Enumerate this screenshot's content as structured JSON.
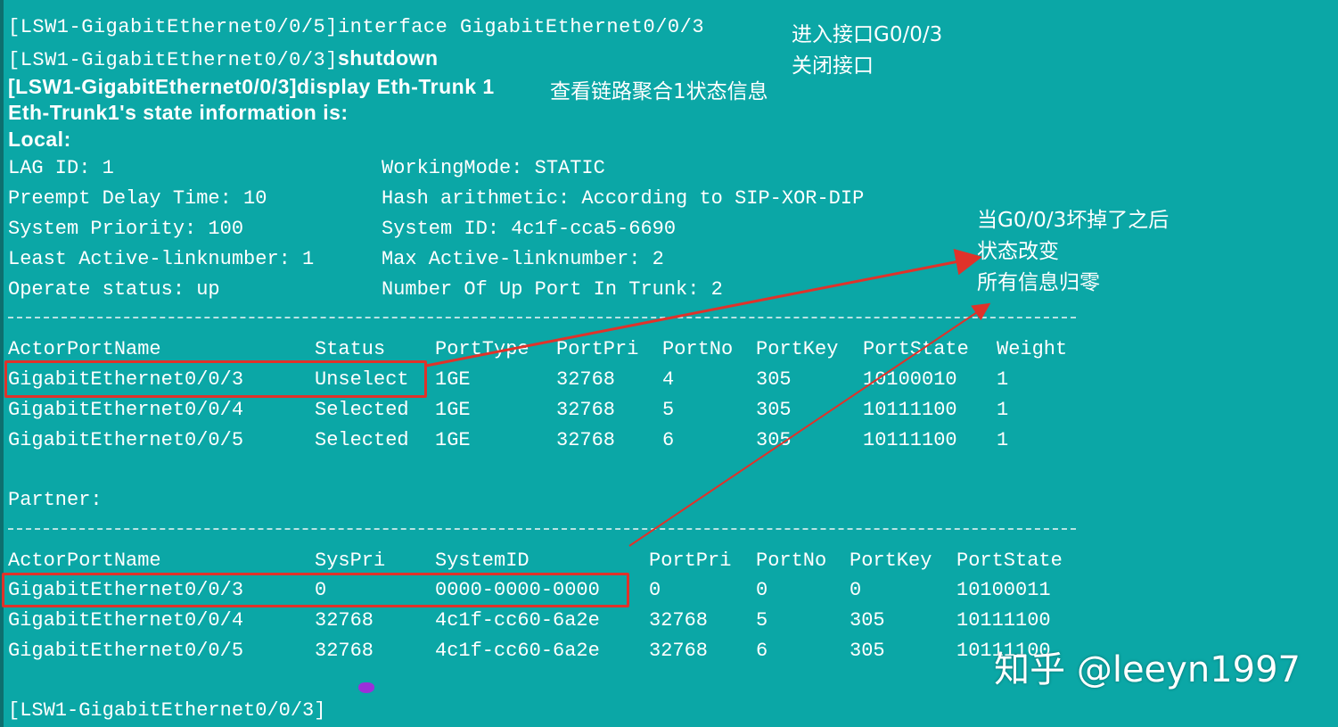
{
  "terminal": {
    "lines": {
      "cmd1": "[LSW1-GigabitEthernet0/0/5]interface GigabitEthernet0/0/3",
      "cmd2_prompt": "[LSW1-GigabitEthernet0/0/3]",
      "cmd2_cmd": "shutdown",
      "cmd3": "[LSW1-GigabitEthernet0/0/3]display Eth-Trunk 1",
      "state_header": "Eth-Trunk1's state information is:",
      "local": "Local:",
      "lag_id": "LAG ID: 1",
      "working_mode": "WorkingMode: STATIC",
      "preempt": "Preempt Delay Time: 10",
      "hash": "Hash arithmetic: According to SIP-XOR-DIP",
      "sys_priority": "System Priority: 100",
      "system_id": "System ID: 4c1f-cca5-6690",
      "least_active": "Least Active-linknumber: 1",
      "max_active": "Max Active-linknumber: 2",
      "operate_status": "Operate status: up",
      "up_ports": "Number Of Up Port In Trunk: 2",
      "partner": "Partner:",
      "final_prompt": "[LSW1-GigabitEthernet0/0/3]"
    },
    "local_table": {
      "headers": [
        "ActorPortName",
        "Status",
        "PortType",
        "PortPri",
        "PortNo",
        "PortKey",
        "PortState",
        "Weight"
      ],
      "rows": [
        [
          "GigabitEthernet0/0/3",
          "Unselect",
          "1GE",
          "32768",
          "4",
          "305",
          "10100010",
          "1"
        ],
        [
          "GigabitEthernet0/0/4",
          "Selected",
          "1GE",
          "32768",
          "5",
          "305",
          "10111100",
          "1"
        ],
        [
          "GigabitEthernet0/0/5",
          "Selected",
          "1GE",
          "32768",
          "6",
          "305",
          "10111100",
          "1"
        ]
      ]
    },
    "partner_table": {
      "headers": [
        "ActorPortName",
        "SysPri",
        "SystemID",
        "PortPri",
        "PortNo",
        "PortKey",
        "PortState"
      ],
      "rows": [
        [
          "GigabitEthernet0/0/3",
          "0",
          "0000-0000-0000",
          "0",
          "0",
          "0",
          "10100011"
        ],
        [
          "GigabitEthernet0/0/4",
          "32768",
          "4c1f-cc60-6a2e",
          "32768",
          "5",
          "305",
          "10111100"
        ],
        [
          "GigabitEthernet0/0/5",
          "32768",
          "4c1f-cc60-6a2e",
          "32768",
          "6",
          "305",
          "10111100"
        ]
      ]
    }
  },
  "annotations": {
    "enter_if": "进入接口G0/0/3",
    "shutdown_if": "关闭接口",
    "view_status": "查看链路聚合1状态信息",
    "after_fail_1": "当G0/0/3坏掉了之后",
    "after_fail_2": "状态改变",
    "after_fail_3": "所有信息归零"
  },
  "watermark": "知乎 @leeyn1997",
  "colors": {
    "background": "#0ba7a6",
    "text": "#ffffff",
    "highlight_box": "#e0322a",
    "arrow": "#e0322a",
    "cursor": "#9b30d9"
  }
}
